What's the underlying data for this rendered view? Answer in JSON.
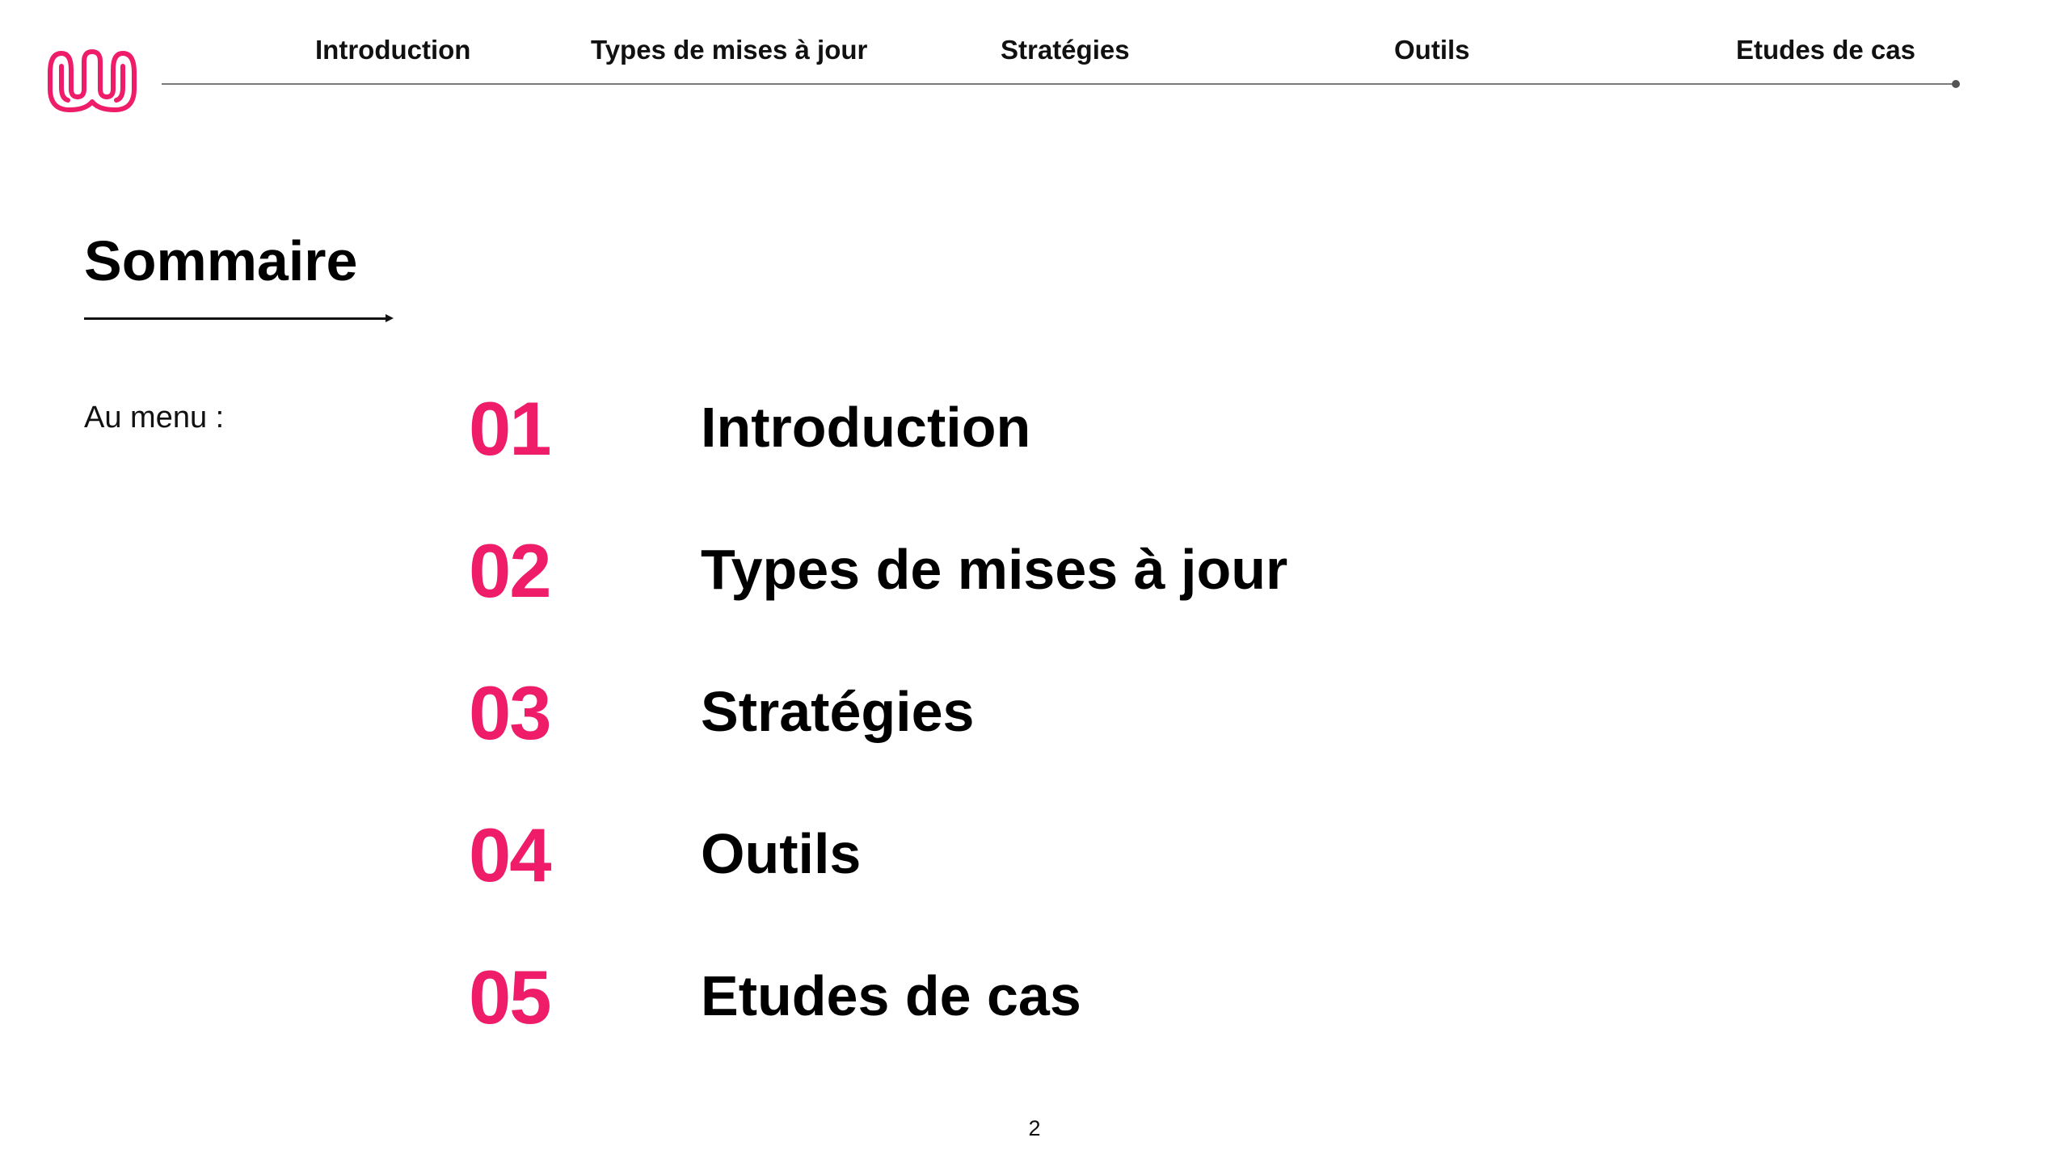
{
  "brand": {
    "logo_icon": "wave-logo-icon",
    "accent_color": "#EE1C69"
  },
  "nav": {
    "items": [
      {
        "label": "Introduction"
      },
      {
        "label": "Types de mises à jour"
      },
      {
        "label": "Stratégies"
      },
      {
        "label": "Outils"
      },
      {
        "label": "Etudes de cas"
      }
    ]
  },
  "page": {
    "title": "Sommaire",
    "menu_label": "Au menu :",
    "number": "2"
  },
  "toc": [
    {
      "number": "01",
      "label": "Introduction"
    },
    {
      "number": "02",
      "label": "Types de mises à jour"
    },
    {
      "number": "03",
      "label": "Stratégies"
    },
    {
      "number": "04",
      "label": "Outils"
    },
    {
      "number": "05",
      "label": "Etudes de cas"
    }
  ]
}
